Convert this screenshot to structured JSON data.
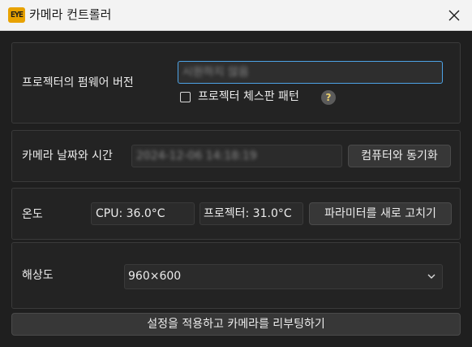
{
  "window": {
    "icon_text": "EYE",
    "title": "카메라 컨트롤러"
  },
  "firmware": {
    "label": "프로젝터의 펌웨어 버전",
    "value": "시원하지 않음",
    "checkbox_label": "프로젝터 체스판 패턴",
    "help_glyph": "?"
  },
  "datetime": {
    "label": "카메라 날짜와 시간",
    "value": "2024-12-06 14:18:19",
    "sync_button": "컴퓨터와 동기화"
  },
  "temperature": {
    "label": "온도",
    "cpu": "CPU: 36.0°C",
    "projector": "프로젝터: 31.0°C",
    "refresh_button": "파라미터를 새로 고치기"
  },
  "resolution": {
    "label": "해상도",
    "selected": "960×600"
  },
  "apply_button": "설정을 적용하고 카메라를 리부팅하기",
  "colors": {
    "background": "#1f1f1f",
    "accent": "#4da3e6",
    "help_icon": "#ebcf6a"
  }
}
